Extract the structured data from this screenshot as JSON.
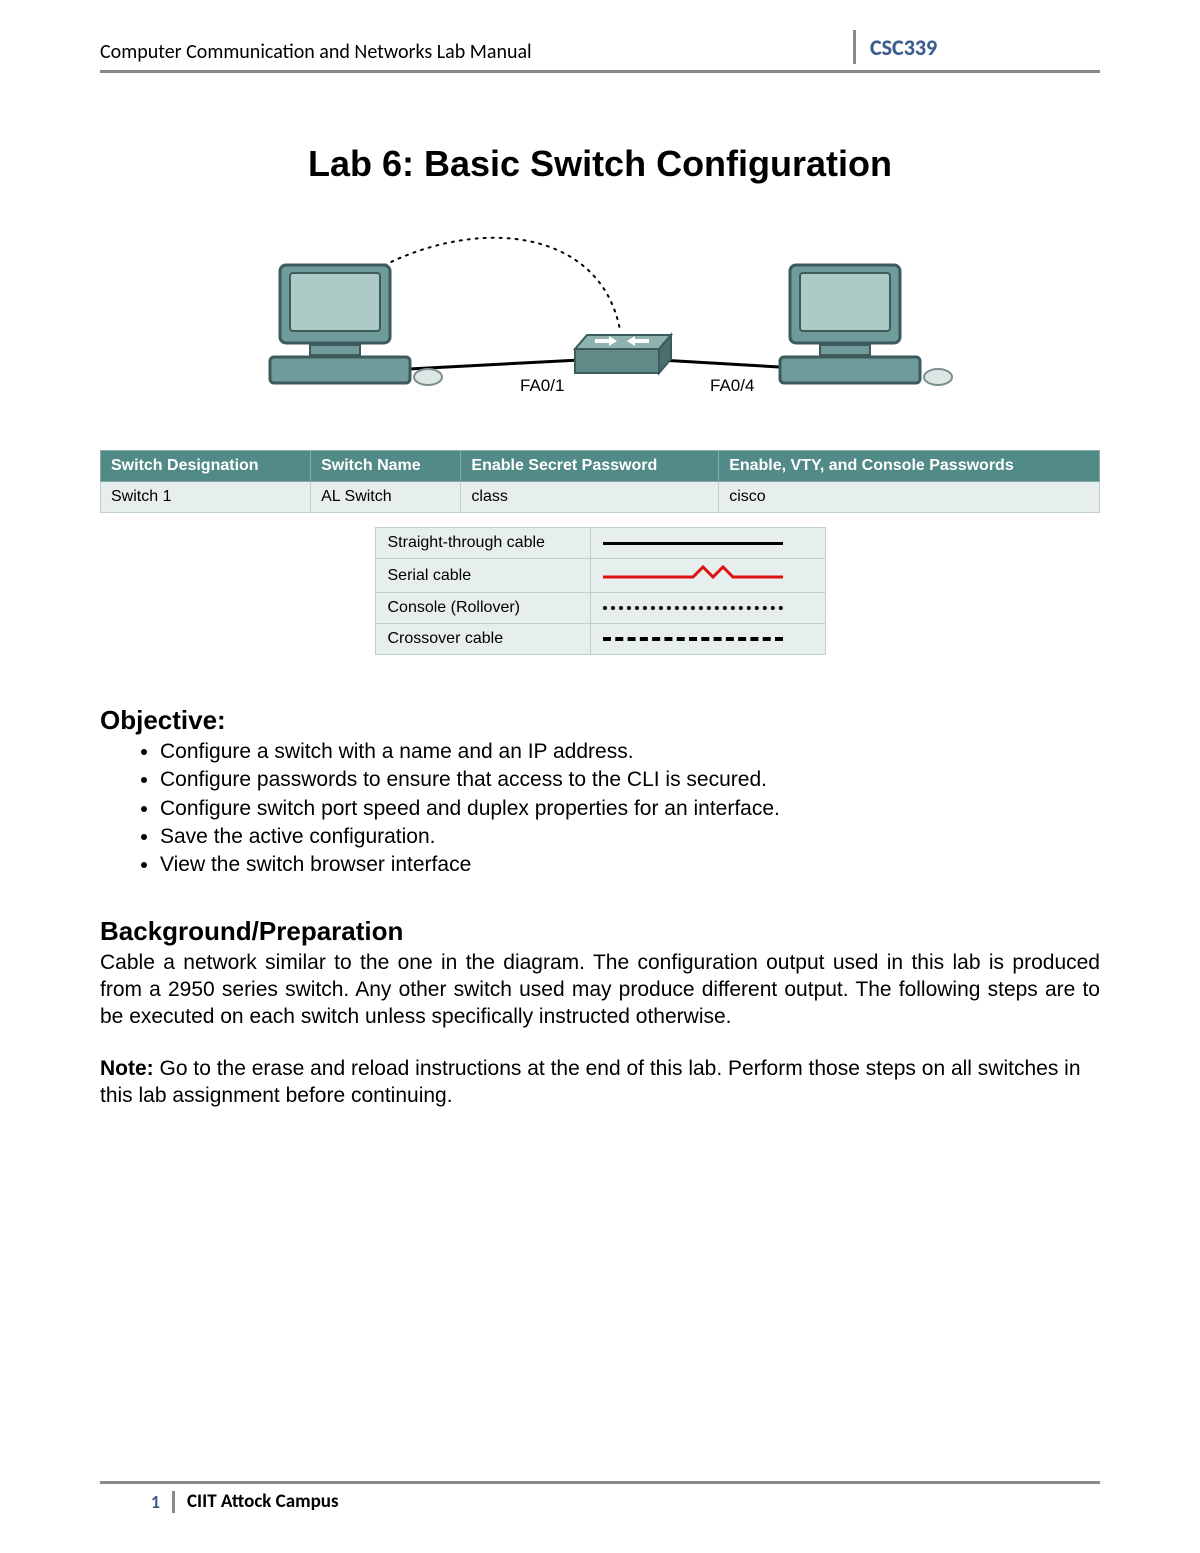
{
  "header": {
    "title": "Computer Communication and Networks Lab Manual",
    "course_code": "CSC339"
  },
  "lab_title": "Lab 6: Basic Switch Configuration",
  "diagram": {
    "port_left": "FA0/1",
    "port_right": "FA0/4"
  },
  "config_table": {
    "headers": {
      "designation": "Switch Designation",
      "name": "Switch Name",
      "secret": "Enable Secret Password",
      "pw": "Enable, VTY, and Console Passwords"
    },
    "row": {
      "designation": "Switch 1",
      "name": "AL Switch",
      "secret": "class",
      "pw": "cisco"
    }
  },
  "legend": {
    "straight": "Straight-through cable",
    "serial": "Serial cable",
    "console": "Console (Rollover)",
    "crossover": "Crossover cable"
  },
  "sections": {
    "objective_heading": "Objective:",
    "objectives": [
      "Configure a switch with a name and an IP address.",
      "Configure passwords to ensure that access to the CLI is secured.",
      "Configure switch port speed and duplex properties for an interface.",
      "Save the active configuration.",
      "View the switch browser interface"
    ],
    "background_heading": "Background/Preparation",
    "background_text": "Cable a network similar to the one in the diagram. The configuration output used in this lab is produced from a 2950 series switch. Any other switch used may produce different output. The following steps are to be executed on each switch unless specifically instructed otherwise.",
    "note_label": "Note:",
    "note_text": " Go to the erase and reload instructions at the end of this lab. Perform those steps on all switches in this lab assignment before continuing."
  },
  "footer": {
    "page": "1",
    "campus": "CIIT Attock Campus"
  }
}
